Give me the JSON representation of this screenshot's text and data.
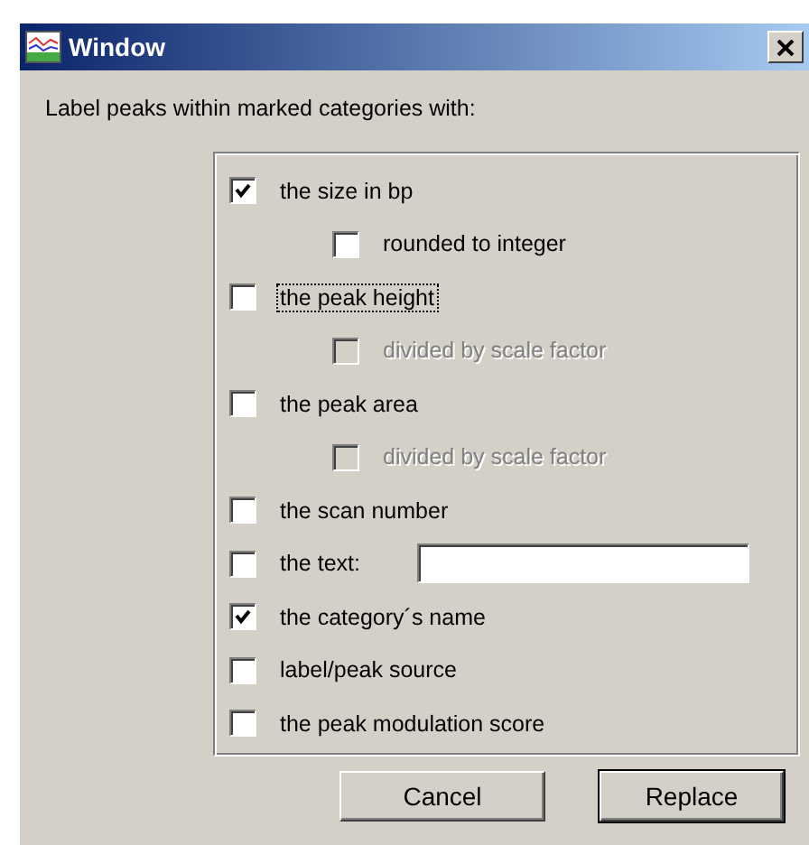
{
  "window": {
    "title": "Window"
  },
  "prompt": "Label peaks within marked categories with:",
  "options": [
    {
      "label": "the size in bp",
      "checked": true,
      "disabled": false,
      "focused": false,
      "children": [
        {
          "label": "rounded to integer",
          "checked": false,
          "disabled": false,
          "focused": false
        }
      ]
    },
    {
      "label": "the peak height",
      "checked": false,
      "disabled": false,
      "focused": true,
      "children": [
        {
          "label": "divided by scale factor",
          "checked": false,
          "disabled": true,
          "focused": false
        }
      ]
    },
    {
      "label": "the peak area",
      "checked": false,
      "disabled": false,
      "focused": false,
      "children": [
        {
          "label": "divided by scale factor",
          "checked": false,
          "disabled": true,
          "focused": false
        }
      ]
    },
    {
      "label": "the scan number",
      "checked": false,
      "disabled": false,
      "focused": false
    },
    {
      "label": "the text:",
      "checked": false,
      "disabled": false,
      "focused": false,
      "kind": "text-entry"
    },
    {
      "label": "the category´s name",
      "checked": true,
      "disabled": false,
      "focused": false
    },
    {
      "label": "label/peak source",
      "checked": false,
      "disabled": false,
      "focused": false
    },
    {
      "label": "the peak modulation score",
      "checked": false,
      "disabled": false,
      "focused": false
    }
  ],
  "buttons": [
    {
      "label": "Cancel",
      "default": false
    },
    {
      "label": "Replace",
      "default": true
    }
  ]
}
